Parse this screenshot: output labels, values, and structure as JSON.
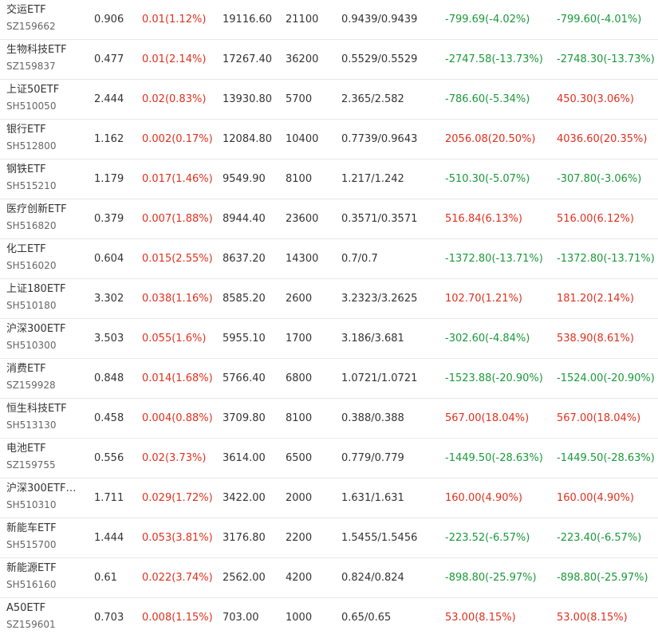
{
  "colors": {
    "up": "#e0311e",
    "down": "#1a9a3a",
    "text": "#333333",
    "subtext": "#666666",
    "divider": "#e8e8e8"
  },
  "rows": [
    {
      "name": "交运ETF",
      "code": "SZ159662",
      "price": "0.906",
      "change": "0.01(1.12%)",
      "change_dir": "up",
      "market_value": "19116.60",
      "quantity": "21100",
      "cost": "0.9439/0.9439",
      "pnl": "-799.69(-4.02%)",
      "pnl_dir": "down",
      "total_pnl": "-799.60(-4.01%)",
      "total_pnl_dir": "down"
    },
    {
      "name": "生物科技ETF",
      "code": "SZ159837",
      "price": "0.477",
      "change": "0.01(2.14%)",
      "change_dir": "up",
      "market_value": "17267.40",
      "quantity": "36200",
      "cost": "0.5529/0.5529",
      "pnl": "-2747.58(-13.73%)",
      "pnl_dir": "down",
      "total_pnl": "-2748.30(-13.73%)",
      "total_pnl_dir": "down"
    },
    {
      "name": "上证50ETF",
      "code": "SH510050",
      "price": "2.444",
      "change": "0.02(0.83%)",
      "change_dir": "up",
      "market_value": "13930.80",
      "quantity": "5700",
      "cost": "2.365/2.582",
      "pnl": "-786.60(-5.34%)",
      "pnl_dir": "down",
      "total_pnl": "450.30(3.06%)",
      "total_pnl_dir": "up"
    },
    {
      "name": "银行ETF",
      "code": "SH512800",
      "price": "1.162",
      "change": "0.002(0.17%)",
      "change_dir": "up",
      "market_value": "12084.80",
      "quantity": "10400",
      "cost": "0.7739/0.9643",
      "pnl": "2056.08(20.50%)",
      "pnl_dir": "up",
      "total_pnl": "4036.60(20.35%)",
      "total_pnl_dir": "up"
    },
    {
      "name": "钢铁ETF",
      "code": "SH515210",
      "price": "1.179",
      "change": "0.017(1.46%)",
      "change_dir": "up",
      "market_value": "9549.90",
      "quantity": "8100",
      "cost": "1.217/1.242",
      "pnl": "-510.30(-5.07%)",
      "pnl_dir": "down",
      "total_pnl": "-307.80(-3.06%)",
      "total_pnl_dir": "down"
    },
    {
      "name": "医疗创新ETF",
      "code": "SH516820",
      "price": "0.379",
      "change": "0.007(1.88%)",
      "change_dir": "up",
      "market_value": "8944.40",
      "quantity": "23600",
      "cost": "0.3571/0.3571",
      "pnl": "516.84(6.13%)",
      "pnl_dir": "up",
      "total_pnl": "516.00(6.12%)",
      "total_pnl_dir": "up"
    },
    {
      "name": "化工ETF",
      "code": "SH516020",
      "price": "0.604",
      "change": "0.015(2.55%)",
      "change_dir": "up",
      "market_value": "8637.20",
      "quantity": "14300",
      "cost": "0.7/0.7",
      "pnl": "-1372.80(-13.71%)",
      "pnl_dir": "down",
      "total_pnl": "-1372.80(-13.71%)",
      "total_pnl_dir": "down"
    },
    {
      "name": "上证180ETF",
      "code": "SH510180",
      "price": "3.302",
      "change": "0.038(1.16%)",
      "change_dir": "up",
      "market_value": "8585.20",
      "quantity": "2600",
      "cost": "3.2323/3.2625",
      "pnl": "102.70(1.21%)",
      "pnl_dir": "up",
      "total_pnl": "181.20(2.14%)",
      "total_pnl_dir": "up"
    },
    {
      "name": "沪深300ETF",
      "code": "SH510300",
      "price": "3.503",
      "change": "0.055(1.6%)",
      "change_dir": "up",
      "market_value": "5955.10",
      "quantity": "1700",
      "cost": "3.186/3.681",
      "pnl": "-302.60(-4.84%)",
      "pnl_dir": "down",
      "total_pnl": "538.90(8.61%)",
      "total_pnl_dir": "up"
    },
    {
      "name": "消费ETF",
      "code": "SZ159928",
      "price": "0.848",
      "change": "0.014(1.68%)",
      "change_dir": "up",
      "market_value": "5766.40",
      "quantity": "6800",
      "cost": "1.0721/1.0721",
      "pnl": "-1523.88(-20.90%)",
      "pnl_dir": "down",
      "total_pnl": "-1524.00(-20.90%)",
      "total_pnl_dir": "down"
    },
    {
      "name": "恒生科技ETF",
      "code": "SH513130",
      "price": "0.458",
      "change": "0.004(0.88%)",
      "change_dir": "up",
      "market_value": "3709.80",
      "quantity": "8100",
      "cost": "0.388/0.388",
      "pnl": "567.00(18.04%)",
      "pnl_dir": "up",
      "total_pnl": "567.00(18.04%)",
      "total_pnl_dir": "up"
    },
    {
      "name": "电池ETF",
      "code": "SZ159755",
      "price": "0.556",
      "change": "0.02(3.73%)",
      "change_dir": "up",
      "market_value": "3614.00",
      "quantity": "6500",
      "cost": "0.779/0.779",
      "pnl": "-1449.50(-28.63%)",
      "pnl_dir": "down",
      "total_pnl": "-1449.50(-28.63%)",
      "total_pnl_dir": "down"
    },
    {
      "name": "沪深300ETF…",
      "code": "SH510310",
      "price": "1.711",
      "change": "0.029(1.72%)",
      "change_dir": "up",
      "market_value": "3422.00",
      "quantity": "2000",
      "cost": "1.631/1.631",
      "pnl": "160.00(4.90%)",
      "pnl_dir": "up",
      "total_pnl": "160.00(4.90%)",
      "total_pnl_dir": "up"
    },
    {
      "name": "新能车ETF",
      "code": "SH515700",
      "price": "1.444",
      "change": "0.053(3.81%)",
      "change_dir": "up",
      "market_value": "3176.80",
      "quantity": "2200",
      "cost": "1.5455/1.5456",
      "pnl": "-223.52(-6.57%)",
      "pnl_dir": "down",
      "total_pnl": "-223.40(-6.57%)",
      "total_pnl_dir": "down"
    },
    {
      "name": "新能源ETF",
      "code": "SH516160",
      "price": "0.61",
      "change": "0.022(3.74%)",
      "change_dir": "up",
      "market_value": "2562.00",
      "quantity": "4200",
      "cost": "0.824/0.824",
      "pnl": "-898.80(-25.97%)",
      "pnl_dir": "down",
      "total_pnl": "-898.80(-25.97%)",
      "total_pnl_dir": "down"
    },
    {
      "name": "A50ETF",
      "code": "SZ159601",
      "price": "0.703",
      "change": "0.008(1.15%)",
      "change_dir": "up",
      "market_value": "703.00",
      "quantity": "1000",
      "cost": "0.65/0.65",
      "pnl": "53.00(8.15%)",
      "pnl_dir": "up",
      "total_pnl": "53.00(8.15%)",
      "total_pnl_dir": "up"
    }
  ]
}
